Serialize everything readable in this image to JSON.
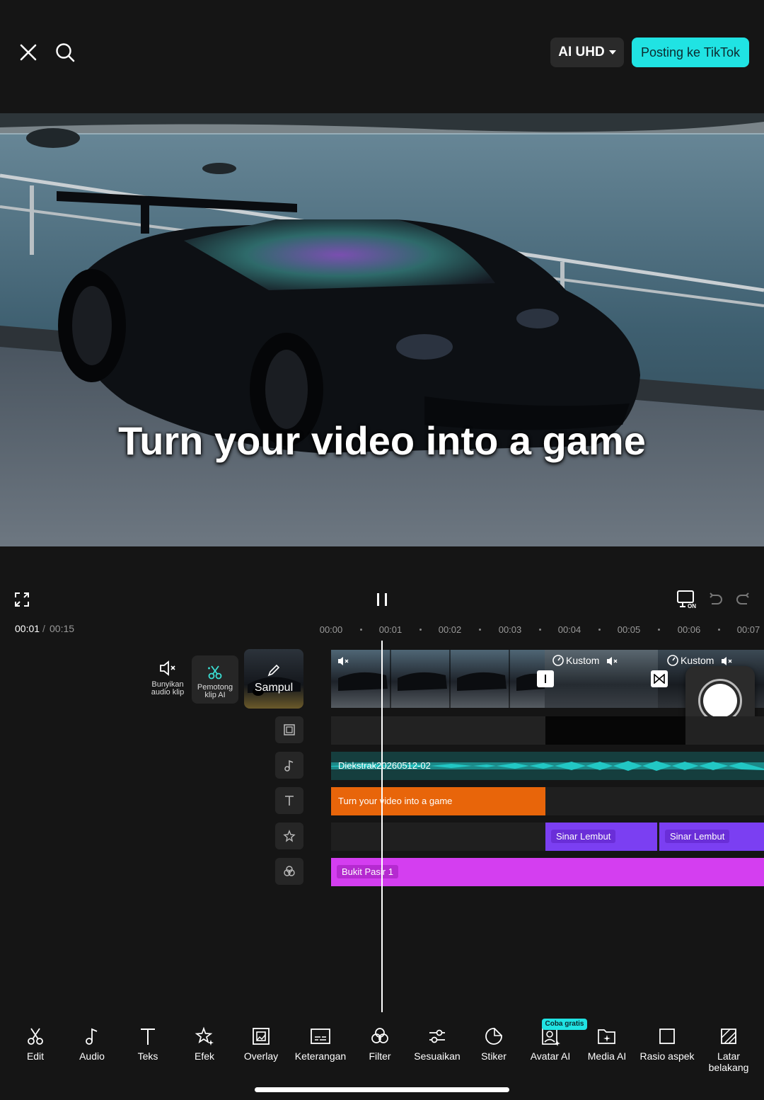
{
  "header": {
    "resolution_label": "AI UHD",
    "post_button_label": "Posting ke TikTok"
  },
  "preview": {
    "caption_text": "Turn your video into a game"
  },
  "playback": {
    "current_time": "00:01",
    "separator": "/",
    "total_time": "00:15"
  },
  "ruler": {
    "ticks": [
      "00:00",
      "00:01",
      "00:02",
      "00:03",
      "00:04",
      "00:05",
      "00:06",
      "00:07"
    ]
  },
  "side_tools": {
    "mute_label": "Bunyikan audio klip",
    "ai_cut_label": "Pemotong klip AI",
    "cover_label": "Sampul"
  },
  "timeline": {
    "custom_label_1": "Kustom",
    "custom_label_2": "Kustom",
    "audio_clip_name": "Diekstrak20260512-02",
    "text_clip": "Turn your video into a game",
    "effect_clip_1": "Sinar Lembut",
    "effect_clip_2": "Sinar Lembut",
    "filter_clip": "Bukit Pasir 1"
  },
  "bottom_nav": {
    "items": [
      {
        "label": "Edit",
        "icon": "scissors-icon"
      },
      {
        "label": "Audio",
        "icon": "music-note-icon"
      },
      {
        "label": "Teks",
        "icon": "text-icon"
      },
      {
        "label": "Efek",
        "icon": "star-sparkle-icon"
      },
      {
        "label": "Overlay",
        "icon": "overlay-icon"
      },
      {
        "label": "Keterangan",
        "icon": "captions-icon"
      },
      {
        "label": "Filter",
        "icon": "filter-icon"
      },
      {
        "label": "Sesuaikan",
        "icon": "sliders-icon"
      },
      {
        "label": "Stiker",
        "icon": "sticker-icon"
      },
      {
        "label": "Avatar AI",
        "icon": "avatar-ai-icon"
      },
      {
        "label": "Media AI",
        "icon": "media-ai-icon"
      },
      {
        "label": "Rasio aspek",
        "icon": "aspect-ratio-icon"
      },
      {
        "label": "Latar belakang",
        "icon": "background-icon"
      }
    ],
    "badge_label": "Coba gratis"
  },
  "colors": {
    "accent_cyan": "#20e3e3",
    "text_track": "#e8650a",
    "effect_track": "#7b3ff2",
    "filter_track": "#d43ef0",
    "audio_wave": "#22c7c4"
  }
}
